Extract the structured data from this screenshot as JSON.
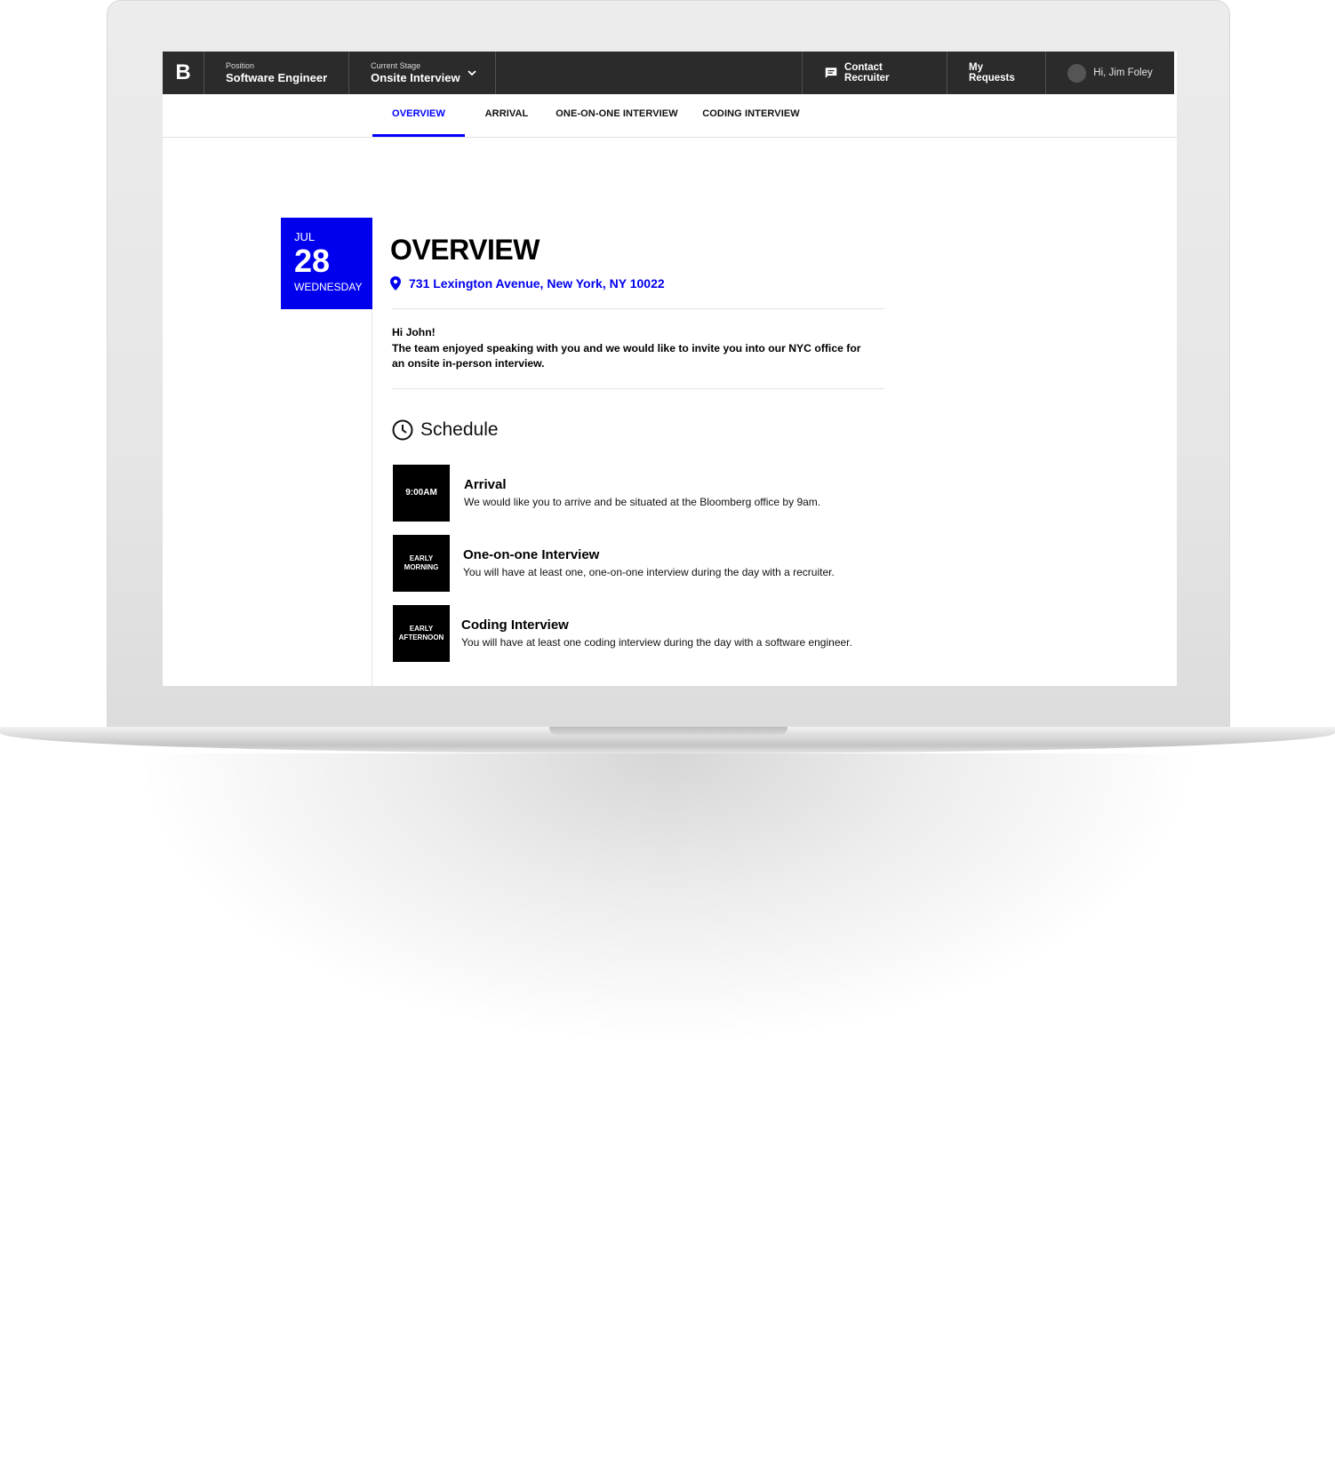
{
  "header": {
    "logo": "B",
    "position_label": "Position",
    "position_value": "Software Engineer",
    "stage_label": "Current Stage",
    "stage_value": "Onsite Interview",
    "contact_label": "Contact Recruiter",
    "requests_label": "My Requests",
    "user_greeting": "Hi, Jim Foley"
  },
  "tabs": [
    {
      "label": "OVERVIEW",
      "active": true
    },
    {
      "label": "ARRIVAL",
      "active": false
    },
    {
      "label": "ONE-ON-ONE INTERVIEW",
      "active": false
    },
    {
      "label": "CODING INTERVIEW",
      "active": false
    }
  ],
  "date": {
    "month": "JUL",
    "day": "28",
    "weekday": "WEDNESDAY"
  },
  "overview": {
    "title": "OVERVIEW",
    "address": "731 Lexington Avenue, New York, NY 10022",
    "greeting": "Hi John!",
    "message": "The team enjoyed speaking with you and we would like to invite you into our NYC office for an onsite in-person interview."
  },
  "schedule": {
    "heading": "Schedule",
    "items": [
      {
        "time": "9:00AM",
        "title": "Arrival",
        "desc": "We would like you to arrive and be situated at the Bloomberg office by 9am."
      },
      {
        "time_line1": "EARLY",
        "time_line2": "MORNING",
        "title": "One-on-one Interview",
        "desc": "You will have at least one, one-on-one interview during the day with a recruiter."
      },
      {
        "time_line1": "EARLY",
        "time_line2": "AFTERNOON",
        "title": "Coding Interview",
        "desc": "You will have at least one coding interview during the day with a software engineer."
      }
    ]
  },
  "colors": {
    "accent": "#0000ee",
    "topbar": "#2b2b2b"
  },
  "icons": [
    "chat-icon",
    "chevron-down-icon",
    "location-pin-icon",
    "clock-icon",
    "avatar"
  ]
}
